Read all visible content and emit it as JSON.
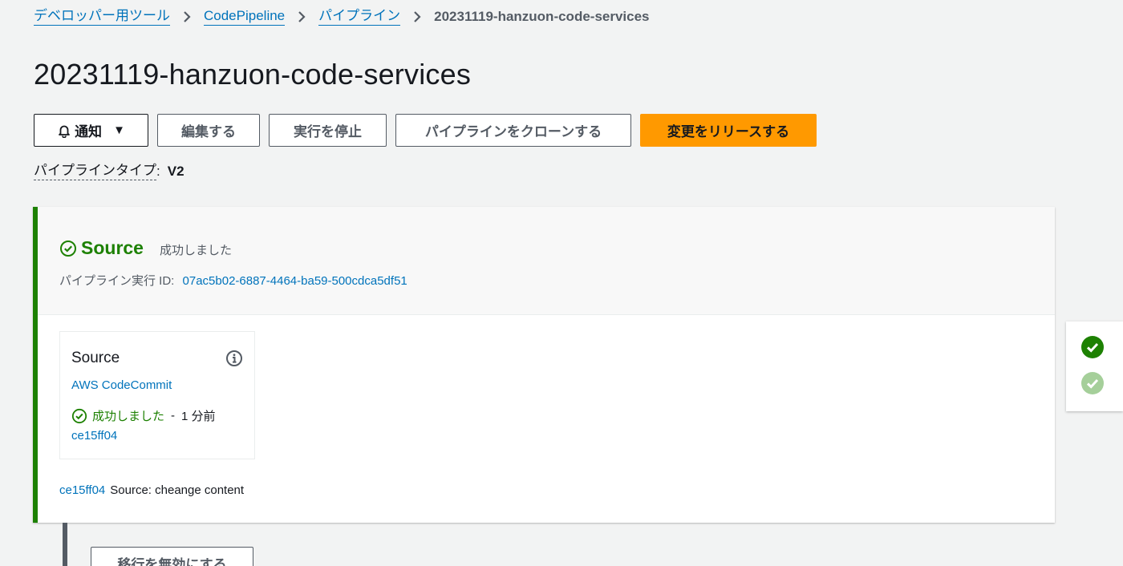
{
  "breadcrumb": {
    "items": [
      "デベロッパー用ツール",
      "CodePipeline",
      "パイプライン"
    ],
    "current": "20231119-hanzuon-code-services"
  },
  "page": {
    "title": "20231119-hanzuon-code-services"
  },
  "actions": {
    "notify": "通知",
    "edit": "編集する",
    "stop": "実行を停止",
    "clone": "パイプラインをクローンする",
    "release": "変更をリリースする"
  },
  "pipeline_type": {
    "label": "パイプラインタイプ",
    "value": "V2"
  },
  "stage": {
    "name": "Source",
    "status": "成功しました",
    "execution_label": "パイプライン実行 ID:",
    "execution_id": "07ac5b02-6887-4464-ba59-500cdca5df51",
    "action": {
      "title": "Source",
      "provider": "AWS CodeCommit",
      "status": "成功しました",
      "time": "1 分前",
      "commit": "ce15ff04"
    },
    "commit": {
      "id": "ce15ff04",
      "message": "Source: cheange content"
    }
  },
  "transition": {
    "button": "移行を無効にする"
  },
  "colors": {
    "success": "#1d8102",
    "primary": "#ff9900",
    "link": "#0073bb"
  }
}
